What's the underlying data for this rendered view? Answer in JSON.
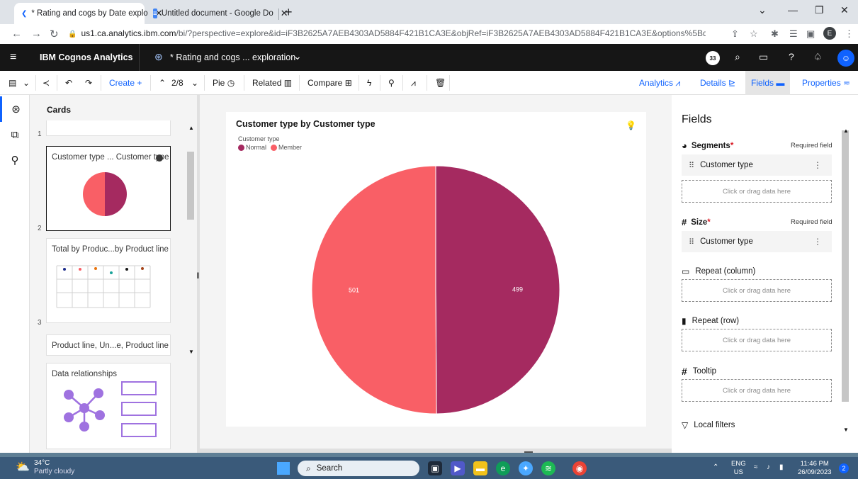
{
  "browser": {
    "tabs": [
      {
        "title": "* Rating and cogs by Date explo",
        "active": true
      },
      {
        "title": "Untitled document - Google Do",
        "active": false
      }
    ],
    "url_main": "us1.ca.analytics.ibm.com",
    "url_rest": "/bi/?perspective=explore&id=iF3B2625A7AEB4303AD5884F421B1CA3E&objRef=iF3B2625A7AEB4303AD5884F421B1CA3E&options%5BdisableGlassPrefetch%5...",
    "profile_letter": "E"
  },
  "app": {
    "brand": "IBM Cognos Analytics",
    "exploration_title": "* Rating and cogs ... exploration",
    "notification_count": "33"
  },
  "toolbar": {
    "create_label": "Create",
    "page_indicator": "2/8",
    "pie_label": "Pie",
    "related_label": "Related",
    "compare_label": "Compare",
    "right_tabs": [
      "Analytics",
      "Details",
      "Fields",
      "Properties"
    ]
  },
  "cards": {
    "title": "Cards",
    "numbers": [
      "1",
      "2",
      "3"
    ],
    "items": [
      {
        "title": "Customer type ... Customer type"
      },
      {
        "title": "Total by Produc...by Product line"
      },
      {
        "title": "Product line, Un...e, Product line"
      },
      {
        "title": "Data relationships"
      }
    ]
  },
  "chart": {
    "title": "Customer type by Customer type",
    "legend_title": "Customer type",
    "colors": {
      "Normal": "#a52a60",
      "Member": "#f95f66"
    }
  },
  "chart_data": {
    "type": "pie",
    "title": "Customer type by Customer type",
    "legend_title": "Customer type",
    "categories": [
      "Normal",
      "Member"
    ],
    "values": [
      499,
      501
    ],
    "colors": [
      "#a52a60",
      "#f95f66"
    ],
    "legend_position": "top-left"
  },
  "fields": {
    "title": "Fields",
    "segments_label": "Segments",
    "size_label": "Size",
    "required_text": "Required field",
    "segments_field": "Customer type",
    "size_field": "Customer type",
    "drop_text": "Click or drag data here",
    "repeat_column": "Repeat (column)",
    "repeat_row": "Repeat (row)",
    "tooltip": "Tooltip",
    "local_filters": "Local filters"
  },
  "taskbar": {
    "temperature": "34°C",
    "weather": "Partly cloudy",
    "search_label": "Search",
    "lang_top": "ENG",
    "lang_bottom": "US",
    "time": "11:46 PM",
    "date": "26/09/2023",
    "notif_count": "2"
  }
}
